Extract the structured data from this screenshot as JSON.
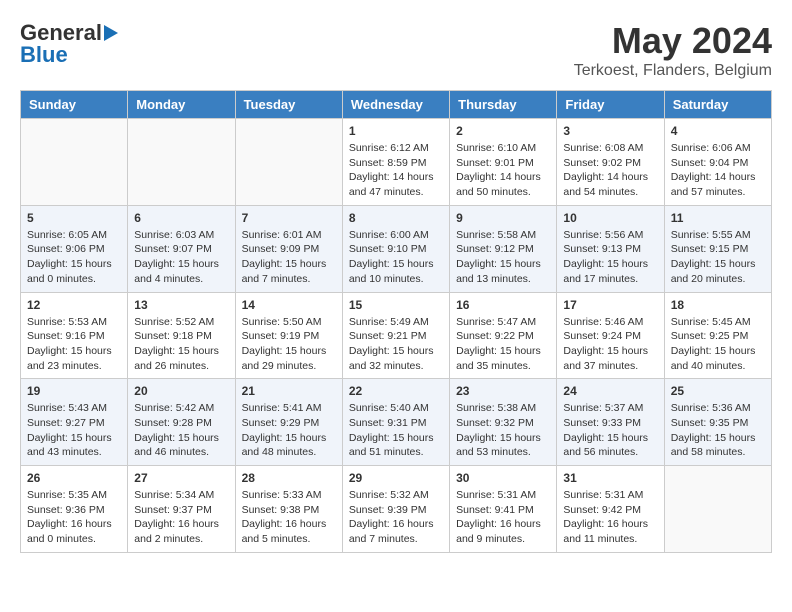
{
  "header": {
    "logo_line1": "General",
    "logo_line2": "Blue",
    "title": "May 2024",
    "subtitle": "Terkoest, Flanders, Belgium"
  },
  "weekdays": [
    "Sunday",
    "Monday",
    "Tuesday",
    "Wednesday",
    "Thursday",
    "Friday",
    "Saturday"
  ],
  "weeks": [
    [
      {
        "day": "",
        "info": ""
      },
      {
        "day": "",
        "info": ""
      },
      {
        "day": "",
        "info": ""
      },
      {
        "day": "1",
        "info": "Sunrise: 6:12 AM\nSunset: 8:59 PM\nDaylight: 14 hours\nand 47 minutes."
      },
      {
        "day": "2",
        "info": "Sunrise: 6:10 AM\nSunset: 9:01 PM\nDaylight: 14 hours\nand 50 minutes."
      },
      {
        "day": "3",
        "info": "Sunrise: 6:08 AM\nSunset: 9:02 PM\nDaylight: 14 hours\nand 54 minutes."
      },
      {
        "day": "4",
        "info": "Sunrise: 6:06 AM\nSunset: 9:04 PM\nDaylight: 14 hours\nand 57 minutes."
      }
    ],
    [
      {
        "day": "5",
        "info": "Sunrise: 6:05 AM\nSunset: 9:06 PM\nDaylight: 15 hours\nand 0 minutes."
      },
      {
        "day": "6",
        "info": "Sunrise: 6:03 AM\nSunset: 9:07 PM\nDaylight: 15 hours\nand 4 minutes."
      },
      {
        "day": "7",
        "info": "Sunrise: 6:01 AM\nSunset: 9:09 PM\nDaylight: 15 hours\nand 7 minutes."
      },
      {
        "day": "8",
        "info": "Sunrise: 6:00 AM\nSunset: 9:10 PM\nDaylight: 15 hours\nand 10 minutes."
      },
      {
        "day": "9",
        "info": "Sunrise: 5:58 AM\nSunset: 9:12 PM\nDaylight: 15 hours\nand 13 minutes."
      },
      {
        "day": "10",
        "info": "Sunrise: 5:56 AM\nSunset: 9:13 PM\nDaylight: 15 hours\nand 17 minutes."
      },
      {
        "day": "11",
        "info": "Sunrise: 5:55 AM\nSunset: 9:15 PM\nDaylight: 15 hours\nand 20 minutes."
      }
    ],
    [
      {
        "day": "12",
        "info": "Sunrise: 5:53 AM\nSunset: 9:16 PM\nDaylight: 15 hours\nand 23 minutes."
      },
      {
        "day": "13",
        "info": "Sunrise: 5:52 AM\nSunset: 9:18 PM\nDaylight: 15 hours\nand 26 minutes."
      },
      {
        "day": "14",
        "info": "Sunrise: 5:50 AM\nSunset: 9:19 PM\nDaylight: 15 hours\nand 29 minutes."
      },
      {
        "day": "15",
        "info": "Sunrise: 5:49 AM\nSunset: 9:21 PM\nDaylight: 15 hours\nand 32 minutes."
      },
      {
        "day": "16",
        "info": "Sunrise: 5:47 AM\nSunset: 9:22 PM\nDaylight: 15 hours\nand 35 minutes."
      },
      {
        "day": "17",
        "info": "Sunrise: 5:46 AM\nSunset: 9:24 PM\nDaylight: 15 hours\nand 37 minutes."
      },
      {
        "day": "18",
        "info": "Sunrise: 5:45 AM\nSunset: 9:25 PM\nDaylight: 15 hours\nand 40 minutes."
      }
    ],
    [
      {
        "day": "19",
        "info": "Sunrise: 5:43 AM\nSunset: 9:27 PM\nDaylight: 15 hours\nand 43 minutes."
      },
      {
        "day": "20",
        "info": "Sunrise: 5:42 AM\nSunset: 9:28 PM\nDaylight: 15 hours\nand 46 minutes."
      },
      {
        "day": "21",
        "info": "Sunrise: 5:41 AM\nSunset: 9:29 PM\nDaylight: 15 hours\nand 48 minutes."
      },
      {
        "day": "22",
        "info": "Sunrise: 5:40 AM\nSunset: 9:31 PM\nDaylight: 15 hours\nand 51 minutes."
      },
      {
        "day": "23",
        "info": "Sunrise: 5:38 AM\nSunset: 9:32 PM\nDaylight: 15 hours\nand 53 minutes."
      },
      {
        "day": "24",
        "info": "Sunrise: 5:37 AM\nSunset: 9:33 PM\nDaylight: 15 hours\nand 56 minutes."
      },
      {
        "day": "25",
        "info": "Sunrise: 5:36 AM\nSunset: 9:35 PM\nDaylight: 15 hours\nand 58 minutes."
      }
    ],
    [
      {
        "day": "26",
        "info": "Sunrise: 5:35 AM\nSunset: 9:36 PM\nDaylight: 16 hours\nand 0 minutes."
      },
      {
        "day": "27",
        "info": "Sunrise: 5:34 AM\nSunset: 9:37 PM\nDaylight: 16 hours\nand 2 minutes."
      },
      {
        "day": "28",
        "info": "Sunrise: 5:33 AM\nSunset: 9:38 PM\nDaylight: 16 hours\nand 5 minutes."
      },
      {
        "day": "29",
        "info": "Sunrise: 5:32 AM\nSunset: 9:39 PM\nDaylight: 16 hours\nand 7 minutes."
      },
      {
        "day": "30",
        "info": "Sunrise: 5:31 AM\nSunset: 9:41 PM\nDaylight: 16 hours\nand 9 minutes."
      },
      {
        "day": "31",
        "info": "Sunrise: 5:31 AM\nSunset: 9:42 PM\nDaylight: 16 hours\nand 11 minutes."
      },
      {
        "day": "",
        "info": ""
      }
    ]
  ]
}
